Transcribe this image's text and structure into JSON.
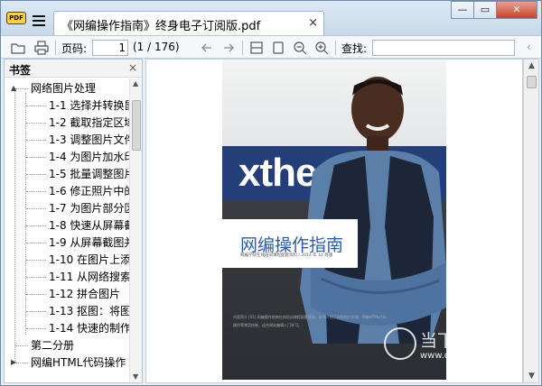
{
  "app": {
    "logo_text": "PDF",
    "tab_title": "《网编操作指南》终身电子订阅版.pdf",
    "tab_close": "×",
    "window_controls": {
      "minimize": "—",
      "restore": "▭",
      "close": "✕"
    }
  },
  "toolbar": {
    "page_label": "页码:",
    "page_value": "1",
    "page_total": "(1 / 176)",
    "search_label": "查找:",
    "search_value": "",
    "search_arrow": "‹"
  },
  "sidebar": {
    "title": "书签",
    "close": "×",
    "items": [
      {
        "label": "网络图片处理",
        "level": 0,
        "expander": "▲"
      },
      {
        "label": "1-1 选择并转换鼠",
        "level": 1
      },
      {
        "label": "1-2 截取指定区域",
        "level": 1
      },
      {
        "label": "1-3 调整图片文件",
        "level": 1
      },
      {
        "label": "1-4 为图片加水印",
        "level": 1
      },
      {
        "label": "1-5 批量调整图片",
        "level": 1
      },
      {
        "label": "1-6 修正照片中的",
        "level": 1
      },
      {
        "label": "1-7 为图片部分区",
        "level": 1
      },
      {
        "label": "1-8 快速从屏幕截",
        "level": 1
      },
      {
        "label": "1-9 从屏幕截图并",
        "level": 1
      },
      {
        "label": "1-10 在图片上添",
        "level": 1
      },
      {
        "label": "1-11 从网络搜索",
        "level": 1
      },
      {
        "label": "1-12 拼合图片",
        "level": 1
      },
      {
        "label": "1-13 抠图：将图",
        "level": 1
      },
      {
        "label": "1-14 快速的制作",
        "level": 1
      },
      {
        "label": "第二分册",
        "level": 0,
        "expander": ""
      },
      {
        "label": "网编HTML代码操作",
        "level": 0,
        "expander": "▶"
      }
    ]
  },
  "page": {
    "banner_text": "xthe  co",
    "guide_title": "网编操作指南",
    "guide_subtitle": "网编学院在线培训课程配套资料 / 2014 年 12 月版",
    "fine_print": "内容简介 [01] 网编操作指南在线培训课程配套资料，本书介绍了网络图片处理、网编HTML代码操作等常用技能，适合网站编辑入门学习。"
  },
  "watermark": {
    "cn": "当下软件园",
    "url": "www.downxia.com"
  },
  "colors": {
    "accent_blue": "#2a5da8",
    "banner_blue": "#243e7a",
    "close_red": "#c6432a"
  }
}
